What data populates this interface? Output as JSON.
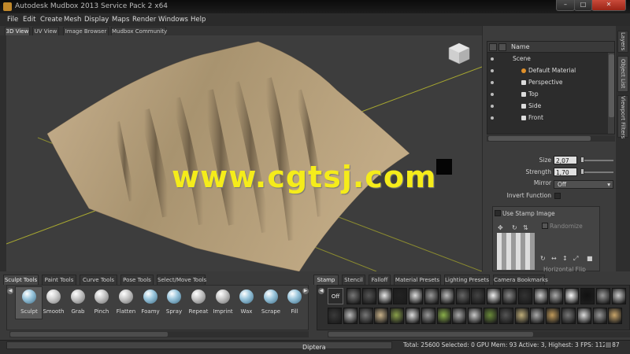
{
  "window": {
    "title": "Autodesk Mudbox 2013 Service Pack 2 x64",
    "minimize_glyph": "–",
    "maximize_glyph": "□",
    "close_glyph": "✕"
  },
  "menu": [
    "File",
    "Edit",
    "Create",
    "Mesh",
    "Display",
    "Maps",
    "Render",
    "Windows",
    "Help"
  ],
  "viewport_tabs": [
    "3D View",
    "UV View",
    "Image Browser",
    "Mudbox Community"
  ],
  "watermark": "www.cgtsj.com",
  "object_list": {
    "column_name": "Name",
    "items": [
      {
        "label": "Scene",
        "indent": 0,
        "icon": "none"
      },
      {
        "label": "Default Material",
        "indent": 1,
        "icon": "material"
      },
      {
        "label": "Perspective",
        "indent": 1,
        "icon": "camera"
      },
      {
        "label": "Top",
        "indent": 1,
        "icon": "camera"
      },
      {
        "label": "Side",
        "indent": 1,
        "icon": "camera"
      },
      {
        "label": "Front",
        "indent": 1,
        "icon": "camera"
      }
    ]
  },
  "properties": {
    "size_label": "Size",
    "size_value": "2,07",
    "strength_label": "Strength",
    "strength_value": "1,70",
    "mirror_label": "Mirror",
    "mirror_value": "Off",
    "invert_label": "Invert Function",
    "use_stamp_label": "Use Stamp Image",
    "randomize_label": "Randomize",
    "horizontal_flip_label": "Horizontal Flip"
  },
  "side_tabs": [
    "Layers",
    "Object List",
    "Viewport Filters"
  ],
  "tool_tabs": [
    "Sculpt Tools",
    "Paint Tools",
    "Curve Tools",
    "Pose Tools",
    "Select/Move Tools"
  ],
  "tools": [
    "Sculpt",
    "Smooth",
    "Grab",
    "Pinch",
    "Flatten",
    "Foamy",
    "Spray",
    "Repeat",
    "Imprint",
    "Wax",
    "Scrape",
    "Fill"
  ],
  "stamp_tabs": [
    "Stamp",
    "Stencil",
    "Falloff",
    "Material Presets",
    "Lighting Presets",
    "Camera Bookmarks"
  ],
  "stamp_off_label": "Off",
  "status": {
    "field": "Diptera",
    "stats": "Total: 25600  Selected: 0 GPU Mem: 93  Active: 3, Highest: 3  FPS: 112.887"
  },
  "colors": {
    "watermark": "#f5ec1a",
    "mesh": "#a08a6a",
    "accent_close": "#c94a3a"
  }
}
